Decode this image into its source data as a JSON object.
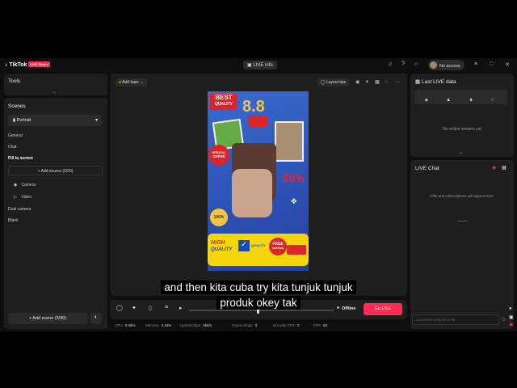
{
  "app": {
    "name": "TikTok",
    "badge": "LIVE Studio"
  },
  "titlebar": {
    "live_info": "LIVE info",
    "access": "No access"
  },
  "tools": {
    "title": "Tools"
  },
  "scenes": {
    "title": "Scenes",
    "orientation": "Portrait",
    "items": [
      "General",
      "Chat",
      "Fill to screen"
    ],
    "add_source": "Add source (2/20)",
    "sources": [
      "Camera",
      "Video"
    ],
    "items2": [
      "Dual camera",
      "Blank"
    ],
    "add_scene": "Add scene (5/30)"
  },
  "preview": {
    "add_topic": "Add topic",
    "layout_tips": "Layout tips",
    "ad": {
      "best": "BEST",
      "quality": "QUALITY",
      "big": "8.8",
      "special": "SPECIAL",
      "offer": "OFFER",
      "percent": "50%",
      "guarantee": "100%",
      "high": "HIGH",
      "quality2": "QUALITY",
      "quality_guarantee": "QUALITY",
      "free": "FREE",
      "shipping": "SHIPPING"
    }
  },
  "controls": {
    "status": "Offline",
    "go_live": "Go LIVE"
  },
  "status_bar": [
    {
      "label": "CPU:",
      "value": "0.06%"
    },
    {
      "label": "Memory:",
      "value": "3.24%"
    },
    {
      "label": "Upload kbps:",
      "value": "0kb/s"
    },
    {
      "label": "Frame drops:",
      "value": "0"
    },
    {
      "label": "Encoder FPS:",
      "value": "0"
    },
    {
      "label": "FPS:",
      "value": "60"
    }
  ],
  "last_live": {
    "title": "Last LIVE data",
    "stats": [
      "-",
      "-",
      "-",
      "-"
    ],
    "empty": "No online viewers yet"
  },
  "live_chat": {
    "title": "LIVE Chat",
    "empty": "Gifts and subscriptions will appear here.",
    "placeholder": "Comments only on LIVE"
  },
  "caption": {
    "line1": "and then kita cuba try kita tunjuk tunjuk",
    "line2": "produk okey tak"
  },
  "colors": {
    "accent": "#fe2c55",
    "panel": "#1e1e1e",
    "background": "#0f0f0f",
    "canvas": "#2f56b9"
  }
}
